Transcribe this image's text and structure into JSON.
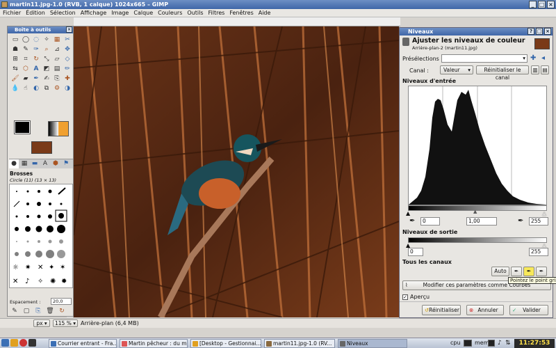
{
  "window": {
    "title": "martin11.jpg-1.0 (RVB, 1 calque) 1024x665 – GIMP"
  },
  "menu": [
    "Fichier",
    "Édition",
    "Sélection",
    "Affichage",
    "Image",
    "Calque",
    "Couleurs",
    "Outils",
    "Filtres",
    "Fenêtres",
    "Aide"
  ],
  "toolbox": {
    "title": "Boîte à outils",
    "brushes_title": "Brosses",
    "brush_name": "Circle (11) (13 × 13)",
    "spacing_label": "Espacement :",
    "spacing_value": "20,0"
  },
  "levels": {
    "window_title": "Niveaux",
    "heading": "Ajuster les niveaux de couleur",
    "subheading": "Arrière-plan-2 (martin11.jpg)",
    "presets_label": "Présélections :",
    "channel_label": "Canal :",
    "channel_value": "Valeur",
    "reset_channel": "Réinitialiser le canal",
    "input_levels_title": "Niveaux d'entrée",
    "input_low": "0",
    "input_gamma": "1,00",
    "input_high": "255",
    "output_levels_title": "Niveaux de sortie",
    "output_low": "0",
    "output_high": "255",
    "all_channels_title": "Tous les canaux",
    "auto_button": "Auto",
    "tooltip": "Pointez le point gris",
    "curves_button": "Modifier ces paramètres comme Courbes",
    "preview_label": "Aperçu",
    "reset_button": "Réinitialiser",
    "cancel_button": "Annuler",
    "ok_button": "Valider"
  },
  "status": {
    "unit": "px",
    "zoom": "115 %",
    "layer_info": "Arrière-plan (6,4 MB)"
  },
  "taskbar": {
    "items": [
      "Courrier entrant - Fra...",
      "Martin pêcheur : du m...",
      "[Desktop - Gestionnai...",
      "martin11.jpg-1.0 (RV...",
      "Niveaux"
    ],
    "tray": [
      "cpu",
      "mem"
    ],
    "clock": "11:27:53"
  },
  "colors": {
    "accent": "#3f66a8",
    "clock_text": "#ffe24a"
  },
  "histogram": {
    "scale": "linear",
    "range": [
      0,
      255
    ]
  }
}
